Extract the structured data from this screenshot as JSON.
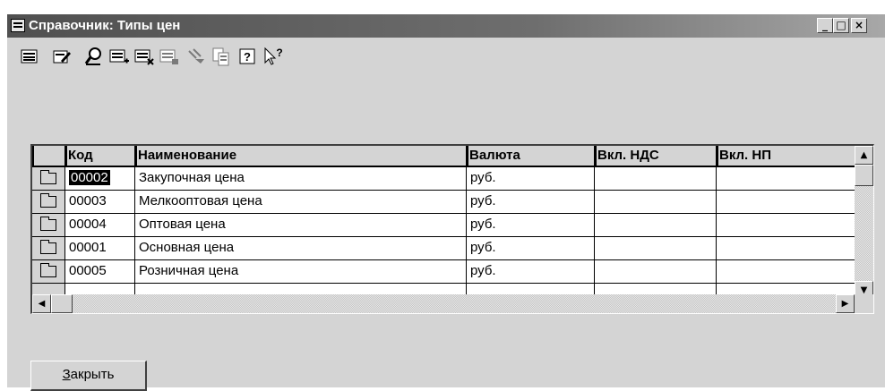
{
  "window": {
    "title": "Справочник: Типы цен",
    "minimize_glyph": "_",
    "maximize_glyph": "□",
    "close_glyph": "×"
  },
  "toolbar": {
    "buttons": [
      {
        "icon": "new-item-icon"
      },
      {
        "icon": "edit-item-icon"
      },
      {
        "icon": "find-icon"
      },
      {
        "icon": "add-row-icon"
      },
      {
        "icon": "delete-row-icon"
      },
      {
        "icon": "print-icon"
      },
      {
        "icon": "filter-icon"
      },
      {
        "icon": "copy-icon"
      },
      {
        "icon": "help-icon",
        "glyph": "?"
      },
      {
        "icon": "context-help-icon",
        "glyph": "?"
      }
    ]
  },
  "table": {
    "columns": [
      "Код",
      "Наименование",
      "Валюта",
      "Вкл. НДС",
      "Вкл. НП"
    ],
    "rows": [
      {
        "code": "00002",
        "name": "Закупочная цена",
        "currency": "руб.",
        "vat": "",
        "np": ""
      },
      {
        "code": "00003",
        "name": "Мелкооптовая цена",
        "currency": "руб.",
        "vat": "",
        "np": ""
      },
      {
        "code": "00004",
        "name": "Оптовая цена",
        "currency": "руб.",
        "vat": "",
        "np": ""
      },
      {
        "code": "00001",
        "name": "Основная цена",
        "currency": "руб.",
        "vat": "",
        "np": ""
      },
      {
        "code": "00005",
        "name": "Розничная цена",
        "currency": "руб.",
        "vat": "",
        "np": ""
      }
    ]
  },
  "close_button": {
    "mnemonic": "З",
    "rest": "акрыть"
  }
}
